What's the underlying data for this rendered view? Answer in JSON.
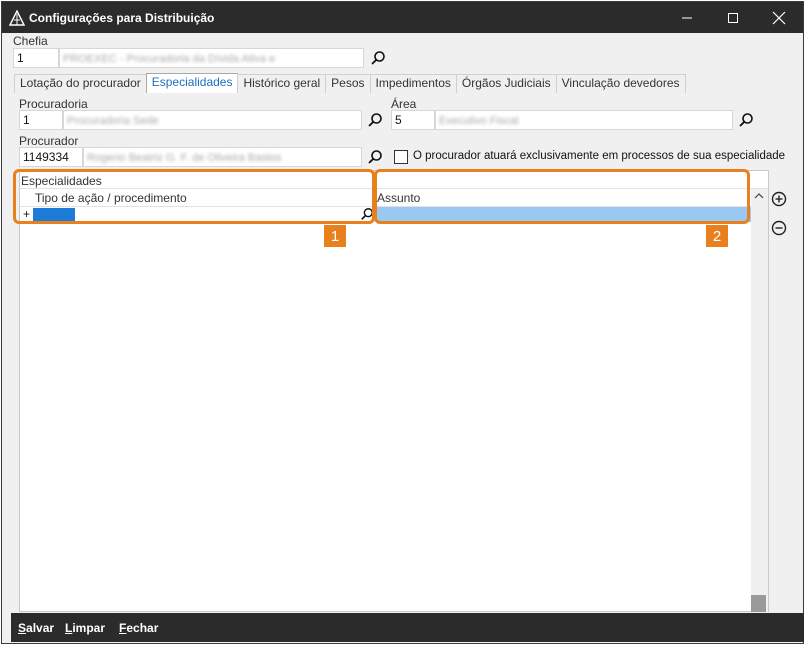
{
  "window": {
    "title": "Configurações para Distribuição"
  },
  "chefia": {
    "label": "Chefia",
    "code": "1",
    "name": "PROEXEC - Procuradoria da Dívida Ativa e"
  },
  "tabs": [
    {
      "label": "Lotação do procurador",
      "active": false
    },
    {
      "label": "Especialidades",
      "active": true
    },
    {
      "label": "Histórico geral",
      "active": false
    },
    {
      "label": "Pesos",
      "active": false
    },
    {
      "label": "Impedimentos",
      "active": false
    },
    {
      "label": "Órgãos Judiciais",
      "active": false
    },
    {
      "label": "Vinculação devedores",
      "active": false
    }
  ],
  "procuradoria": {
    "label": "Procuradoria",
    "code": "1",
    "name": "Procuradoria Sede"
  },
  "area": {
    "label": "Área",
    "code": "5",
    "name": "Executivo Fiscal"
  },
  "procurador": {
    "label": "Procurador",
    "code": "1149334",
    "name": "Rogerio Beatriz G. F. de Oliveira Bastos"
  },
  "exclusive_checkbox": {
    "label": "O procurador atuará exclusivamente em processos de sua especialidade",
    "checked": false
  },
  "grid": {
    "group_label": "Especialidades",
    "columns": [
      "Tipo de ação / procedimento",
      "Assunto"
    ],
    "new_row_marker": "+"
  },
  "callouts": [
    "1",
    "2"
  ],
  "footer": {
    "save": {
      "ul": "S",
      "rest": "alvar"
    },
    "clear": {
      "ul": "L",
      "rest": "impar"
    },
    "close": {
      "ul": "F",
      "rest": "echar"
    }
  },
  "colors": {
    "accent": "#e8801d",
    "selection": "#1e7bd8",
    "selection_light": "#99c9f2",
    "titlebar": "#2b2b2b",
    "active_tab_text": "#1a6fc0"
  }
}
